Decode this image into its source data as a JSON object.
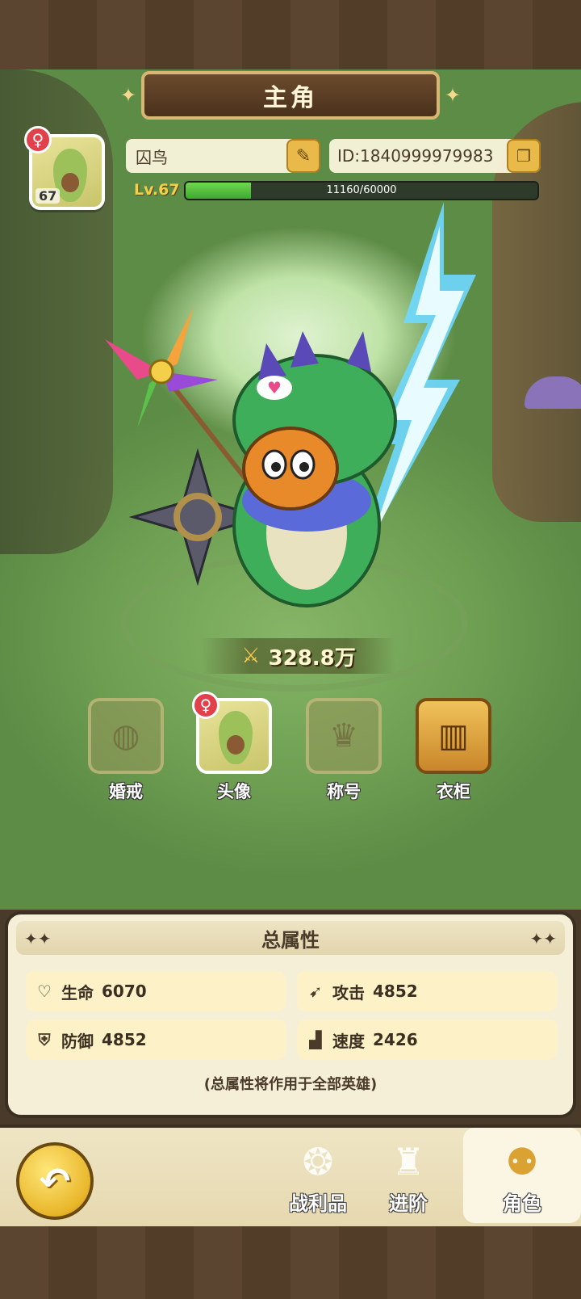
{
  "header": {
    "title": "主角"
  },
  "profile": {
    "name": "囚鸟",
    "id_text": "ID:1840999979983",
    "avatar_level": "67",
    "level_label": "Lv.67",
    "exp_text": "11160/60000",
    "exp_current": 11160,
    "exp_max": 60000,
    "gender_icon": "female-icon"
  },
  "power": {
    "value": "328.8万"
  },
  "features": [
    {
      "label": "婚戒",
      "icon": "ring-icon",
      "enabled": false
    },
    {
      "label": "头像",
      "icon": "avatar-icon",
      "enabled": true
    },
    {
      "label": "称号",
      "icon": "crown-icon",
      "enabled": false
    },
    {
      "label": "衣柜",
      "icon": "wardrobe-icon",
      "enabled": true
    }
  ],
  "attributes": {
    "title": "总属性",
    "items": [
      {
        "label": "生命",
        "value": "6070",
        "icon": "heart-icon"
      },
      {
        "label": "攻击",
        "value": "4852",
        "icon": "attack-icon"
      },
      {
        "label": "防御",
        "value": "4852",
        "icon": "shield-icon"
      },
      {
        "label": "速度",
        "value": "2426",
        "icon": "boot-icon"
      }
    ],
    "note": "(总属性将作用于全部英雄)"
  },
  "nav": {
    "tabs": [
      {
        "label": "战利品",
        "icon": "loot-icon",
        "active": false
      },
      {
        "label": "进阶",
        "icon": "advance-icon",
        "active": false
      },
      {
        "label": "角色",
        "icon": "character-icon",
        "active": true
      }
    ]
  },
  "colors": {
    "exp_bar": "#3fa831",
    "accent_gold": "#e9b94a",
    "gender_badge": "#e0414a"
  }
}
